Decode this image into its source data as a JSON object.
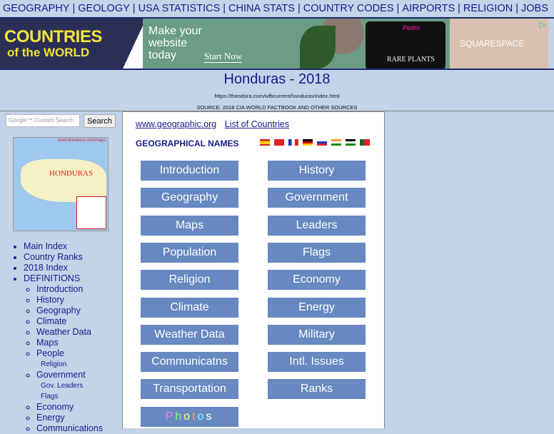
{
  "topnav": [
    "GEOGRAPHY",
    "GEOLOGY",
    "USA STATISTICS",
    "CHINA STATS",
    "COUNTRY CODES",
    "AIRPORTS",
    "RELIGION",
    "JOBS"
  ],
  "logo": {
    "line1": "COUNTRIES",
    "line2": "of the WORLD"
  },
  "ad": {
    "headline_1": "Make your",
    "headline_2": "website",
    "headline_3": "today",
    "cta": "Start Now",
    "tablet_brand": "Pedro",
    "tablet_text": "RARE PLANTS",
    "brand": "SQUARESPACE",
    "adchoice": "▷"
  },
  "header": {
    "title": "Honduras - 2018",
    "url": "https://theodora.com/wfbcurrent/honduras/index.html",
    "source": "SOURCE: 2018 CIA WORLD FACTBOOK AND OTHER SOURCES"
  },
  "search": {
    "placeholder": "Google™ Custom Search",
    "button": "Search"
  },
  "map": {
    "watermark": "www.theodora.com/maps",
    "country": "HONDURAS"
  },
  "sidebar": {
    "top": [
      "Main Index",
      "Country Ranks",
      "2018 Index",
      "DEFINITIONS"
    ],
    "defs": [
      "Introduction",
      "History",
      "Geography",
      "Climate",
      "Weather Data",
      "Maps",
      "People",
      "Religion",
      "Government",
      "Gov. Leaders",
      "Flags",
      "Economy",
      "Energy",
      "Communications"
    ]
  },
  "center": {
    "link1": "www.geographic.org",
    "link2": "List of Countries",
    "geo_names": "GEOGRAPHICAL NAMES",
    "flags": [
      "Spanish",
      "Chinese",
      "French",
      "German",
      "Russian",
      "Hindi",
      "Arabic",
      "Portuguese"
    ],
    "buttons_left": [
      "Introduction",
      "Geography",
      "Maps",
      "Population",
      "Religion",
      "Climate",
      "Weather Data",
      "Communicatns",
      "Transportation"
    ],
    "buttons_right": [
      "History",
      "Government",
      "Leaders",
      "Flags",
      "Economy",
      "Energy",
      "Military",
      "Intl. Issues",
      "Ranks"
    ],
    "photos": [
      "P",
      "h",
      "o",
      "t",
      "o",
      "s"
    ],
    "photo_colors": [
      "#f7f",
      "#7f7",
      "#ff7",
      "#f97",
      "#7ff",
      "#fff"
    ]
  }
}
